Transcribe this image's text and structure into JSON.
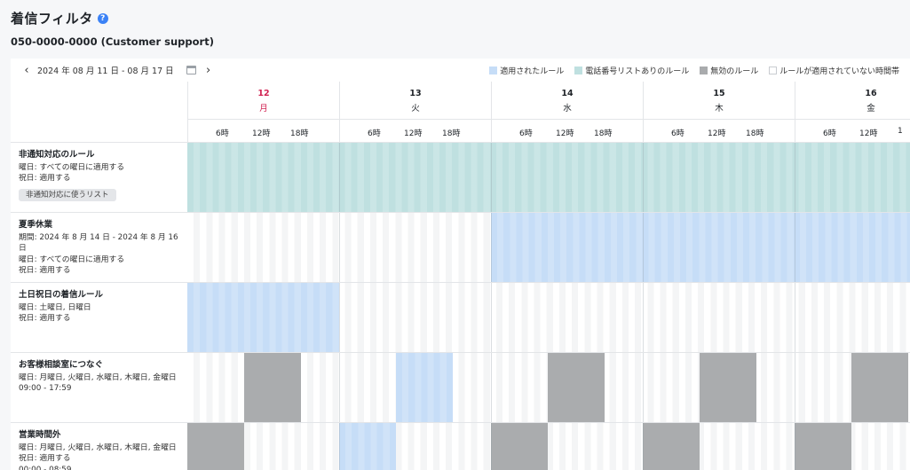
{
  "page": {
    "title": "着信フィルタ",
    "help_glyph": "?",
    "subtitle": "050-0000-0000 (Customer support)"
  },
  "toolbar": {
    "prev_glyph": "‹",
    "next_glyph": "›",
    "date_range": "2024 年 08 月 11 日 - 08 月 17 日",
    "legend": [
      {
        "label": "適用されたルール",
        "color": "#c6ddf7"
      },
      {
        "label": "電話番号リストありのルール",
        "color": "#bfe0e0"
      },
      {
        "label": "無効のルール",
        "color": "#a9abad"
      },
      {
        "label": "ルールが適用されていない時間帯",
        "color": "#ffffff"
      }
    ]
  },
  "days": [
    {
      "num": "12",
      "dow": "月",
      "highlight": true
    },
    {
      "num": "13",
      "dow": "火",
      "highlight": false
    },
    {
      "num": "14",
      "dow": "水",
      "highlight": false
    },
    {
      "num": "15",
      "dow": "木",
      "highlight": false
    },
    {
      "num": "16",
      "dow": "金",
      "highlight": false
    }
  ],
  "hour_labels": [
    "6時",
    "12時",
    "18時"
  ],
  "hour_label_cut": "1",
  "rules": [
    {
      "name": "非通知対応のルール",
      "lines": [
        "曜日: すべての曜日に適用する",
        "祝日: 適用する"
      ],
      "tag": "非通知対応に使うリスト",
      "blocks": [
        {
          "type": "phone",
          "day_start": 0,
          "hour_start": 0,
          "day_end": 4,
          "hour_end": 24
        }
      ]
    },
    {
      "name": "夏季休業",
      "lines": [
        "期間: 2024 年 8 月 14 日 - 2024 年 8 月 16 日",
        "曜日: すべての曜日に適用する",
        "祝日: 適用する"
      ],
      "blocks": [
        {
          "type": "applied",
          "day_start": 2,
          "hour_start": 0,
          "day_end": 4,
          "hour_end": 24
        }
      ]
    },
    {
      "name": "土日祝日の着信ルール",
      "lines": [
        "曜日: 土曜日, 日曜日",
        "祝日: 適用する"
      ],
      "blocks": [
        {
          "type": "applied",
          "day_start": 0,
          "hour_start": 0,
          "day_end": 0,
          "hour_end": 24
        }
      ]
    },
    {
      "name": "お客様相談室につなぐ",
      "lines": [
        "曜日: 月曜日, 火曜日, 水曜日, 木曜日, 金曜日",
        "09:00 - 17:59"
      ],
      "blocks": [
        {
          "type": "disabled",
          "day_start": 0,
          "hour_start": 9,
          "day_end": 0,
          "hour_end": 18
        },
        {
          "type": "applied",
          "day_start": 1,
          "hour_start": 9,
          "day_end": 1,
          "hour_end": 18
        },
        {
          "type": "disabled",
          "day_start": 2,
          "hour_start": 9,
          "day_end": 2,
          "hour_end": 18
        },
        {
          "type": "disabled",
          "day_start": 3,
          "hour_start": 9,
          "day_end": 3,
          "hour_end": 18
        },
        {
          "type": "disabled",
          "day_start": 4,
          "hour_start": 9,
          "day_end": 4,
          "hour_end": 18
        }
      ]
    },
    {
      "name": "営業時間外",
      "lines": [
        "曜日: 月曜日, 火曜日, 水曜日, 木曜日, 金曜日",
        "祝日: 適用する",
        "00:00 - 08:59"
      ],
      "blocks": [
        {
          "type": "disabled",
          "day_start": 0,
          "hour_start": 0,
          "day_end": 0,
          "hour_end": 9
        },
        {
          "type": "applied",
          "day_start": 1,
          "hour_start": 0,
          "day_end": 1,
          "hour_end": 9
        },
        {
          "type": "disabled",
          "day_start": 2,
          "hour_start": 0,
          "day_end": 2,
          "hour_end": 9
        },
        {
          "type": "disabled",
          "day_start": 3,
          "hour_start": 0,
          "day_end": 3,
          "hour_end": 9
        },
        {
          "type": "disabled",
          "day_start": 4,
          "hour_start": 0,
          "day_end": 4,
          "hour_end": 9
        }
      ]
    }
  ]
}
